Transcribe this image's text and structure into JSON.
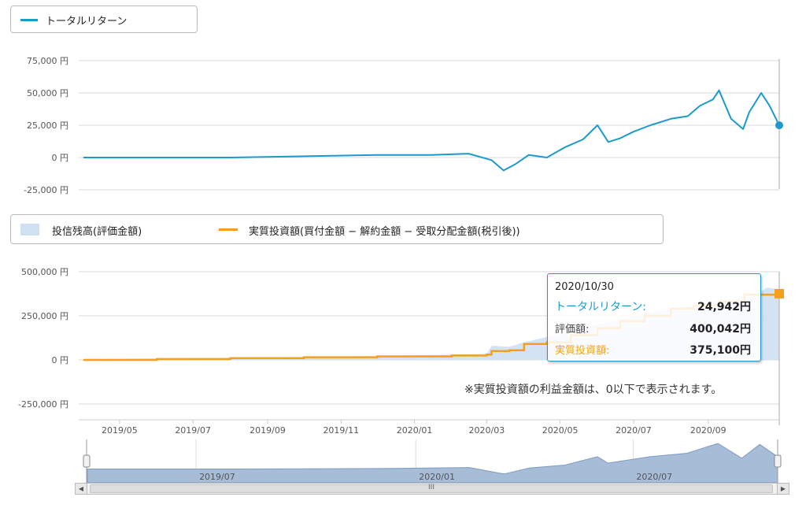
{
  "legend_top": {
    "total_return": "トータルリターン"
  },
  "legend_bottom": {
    "balance": "投信残高(評価金額)",
    "invested": "実質投資額(買付金額 − 解約金額 − 受取分配金額(税引後))"
  },
  "note": "※実質投資額の利益金額は、0以下で表示されます。",
  "tooltip": {
    "date": "2020/10/30",
    "total_return_label": "トータルリターン:",
    "total_return_value": "24,942円",
    "valuation_label": "評価額:",
    "valuation_value": "400,042円",
    "invested_label": "実質投資額:",
    "invested_value": "375,100円"
  },
  "navigator": {
    "scroll_mid": "III"
  },
  "colors": {
    "total_return": "#1b9acb",
    "invested": "#f5a01a",
    "balance_fill": "#cfe0f3",
    "navigator_fill": "#a7bcd7"
  },
  "chart_data": [
    {
      "type": "line",
      "series": [
        {
          "name": "トータルリターン",
          "x": [
            "2019-04-01",
            "2019-06-01",
            "2019-08-01",
            "2019-10-01",
            "2019-12-01",
            "2020-01-15",
            "2020-02-15",
            "2020-03-05",
            "2020-03-15",
            "2020-03-25",
            "2020-04-05",
            "2020-04-20",
            "2020-05-05",
            "2020-05-20",
            "2020-06-01",
            "2020-06-10",
            "2020-06-20",
            "2020-07-01",
            "2020-07-15",
            "2020-08-01",
            "2020-08-15",
            "2020-08-25",
            "2020-09-05",
            "2020-09-10",
            "2020-09-20",
            "2020-09-30",
            "2020-10-05",
            "2020-10-15",
            "2020-10-22",
            "2020-10-30"
          ],
          "values": [
            0,
            0,
            0,
            1000,
            2000,
            2000,
            3000,
            -2000,
            -10000,
            -5000,
            2000,
            0,
            8000,
            14000,
            25000,
            12000,
            15000,
            20000,
            25000,
            30000,
            32000,
            40000,
            45000,
            52000,
            30000,
            22000,
            35000,
            50000,
            40000,
            24942
          ]
        }
      ],
      "yticks": [
        "75,000 円",
        "50,000 円",
        "25,000 円",
        "0 円",
        "-25,000 円"
      ],
      "ylim": [
        -25000,
        75000
      ]
    },
    {
      "type": "area",
      "series": [
        {
          "name": "投信残高(評価金額)",
          "x": [
            "2019-04-01",
            "2019-08-01",
            "2019-12-01",
            "2020-02-01",
            "2020-03-01",
            "2020-03-05",
            "2020-03-20",
            "2020-04-01",
            "2020-04-20",
            "2020-05-10",
            "2020-06-01",
            "2020-06-20",
            "2020-07-10",
            "2020-08-01",
            "2020-08-20",
            "2020-09-10",
            "2020-09-25",
            "2020-10-10",
            "2020-10-20",
            "2020-10-30"
          ],
          "values": [
            5000,
            12000,
            22000,
            30000,
            35000,
            80000,
            75000,
            100000,
            130000,
            160000,
            200000,
            230000,
            260000,
            290000,
            310000,
            340000,
            330000,
            370000,
            410000,
            400042
          ]
        },
        {
          "name": "実質投資額(買付金額 − 解約金額 − 受取分配金額(税引後))",
          "x": [
            "2019-04-01",
            "2019-06-01",
            "2019-08-01",
            "2019-10-01",
            "2019-12-01",
            "2020-02-01",
            "2020-03-01",
            "2020-03-05",
            "2020-03-20",
            "2020-04-01",
            "2020-04-20",
            "2020-05-10",
            "2020-06-01",
            "2020-06-20",
            "2020-07-10",
            "2020-08-01",
            "2020-08-20",
            "2020-09-10",
            "2020-10-01",
            "2020-10-30"
          ],
          "values": [
            0,
            5000,
            10000,
            15000,
            20000,
            25000,
            30000,
            50000,
            55000,
            90000,
            100000,
            140000,
            180000,
            220000,
            250000,
            290000,
            310000,
            330000,
            370000,
            375100
          ]
        }
      ],
      "yticks": [
        "500,000 円",
        "250,000 円",
        "0 円",
        "-250,000 円"
      ],
      "ylim": [
        -250000,
        500000
      ],
      "xticks": [
        "2019/05",
        "2019/07",
        "2019/09",
        "2019/11",
        "2020/01",
        "2020/03",
        "2020/05",
        "2020/07",
        "2020/09"
      ]
    },
    {
      "type": "area",
      "series": [
        {
          "name": "トータルリターン",
          "x": [
            "2019-04-01",
            "2019-08-01",
            "2019-12-01",
            "2020-02-15",
            "2020-03-15",
            "2020-04-05",
            "2020-05-05",
            "2020-06-01",
            "2020-06-10",
            "2020-07-15",
            "2020-08-15",
            "2020-09-10",
            "2020-09-30",
            "2020-10-15",
            "2020-10-30"
          ],
          "values": [
            0,
            0,
            1000,
            3000,
            -10000,
            2000,
            8000,
            25000,
            12000,
            25000,
            32000,
            52000,
            22000,
            50000,
            24942
          ]
        }
      ],
      "xticks": [
        "2019/07",
        "2020/01",
        "2020/07"
      ]
    }
  ]
}
